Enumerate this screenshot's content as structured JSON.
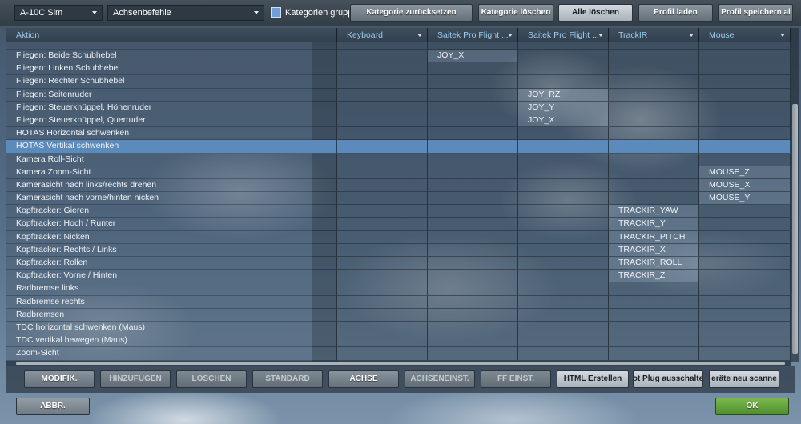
{
  "colors": {
    "header_text": "#9ccbee",
    "selection": "#5b8abb",
    "checkbox": "#6e9fd8",
    "ok_button": "#4f8f2c"
  },
  "icons": {
    "dropdown_arrow": "chevron-down-icon",
    "checkbox": "checkbox-checked-icon"
  },
  "toolbar": {
    "aircraft": "A-10C Sim",
    "category": "Achsenbefehle",
    "group_label": "Kategorien gruppi",
    "group_checked": true,
    "reset_category": "Kategorie zurücksetzen",
    "clear_category": "Kategorie löschen",
    "clear_all": "Alle löschen",
    "load_profile": "Profil laden",
    "save_profile_as": "Profil speichern al"
  },
  "table": {
    "headers": {
      "action": "Aktion",
      "keyboard": "Keyboard",
      "device1": "Saitek Pro Flight ...",
      "device2": "Saitek Pro Flight ...",
      "trackir": "TrackIR",
      "mouse": "Mouse"
    },
    "rows": [
      {
        "action": "Fliegen: Beide Schubhebel",
        "device1": "JOY_X"
      },
      {
        "action": "Fliegen: Linken Schubhebel"
      },
      {
        "action": "Fliegen: Rechter Schubhebel"
      },
      {
        "action": "Fliegen: Seitenruder",
        "device2": "JOY_RZ"
      },
      {
        "action": "Fliegen: Steuerknüppel, Höhenruder",
        "device2": "JOY_Y"
      },
      {
        "action": "Fliegen: Steuerknüppel, Querruder",
        "device2": "JOY_X"
      },
      {
        "action": "HOTAS Horizontal schwenken"
      },
      {
        "action": "HOTAS Vertikal schwenken",
        "selected": true
      },
      {
        "action": "Kamera Roll-Sicht"
      },
      {
        "action": "Kamera Zoom-Sicht",
        "mouse": "MOUSE_Z"
      },
      {
        "action": "Kamerasicht nach links/rechts drehen",
        "mouse": "MOUSE_X"
      },
      {
        "action": "Kamerasicht nach vorne/hinten nicken",
        "mouse": "MOUSE_Y"
      },
      {
        "action": "Kopftracker: Gieren",
        "trackir": "TRACKIR_YAW"
      },
      {
        "action": "Kopftracker: Hoch / Runter",
        "trackir": "TRACKIR_Y"
      },
      {
        "action": "Kopftracker: Nicken",
        "trackir": "TRACKIR_PITCH"
      },
      {
        "action": "Kopftracker: Rechts / Links",
        "trackir": "TRACKIR_X"
      },
      {
        "action": "Kopftracker: Rollen",
        "trackir": "TRACKIR_ROLL"
      },
      {
        "action": "Kopftracker: Vorne / Hinten",
        "trackir": "TRACKIR_Z"
      },
      {
        "action": "Radbremse links"
      },
      {
        "action": "Radbremse rechts"
      },
      {
        "action": "Radbremsen"
      },
      {
        "action": "TDC horizontal schwenken (Maus)"
      },
      {
        "action": "TDC vertikal bewegen (Maus)"
      },
      {
        "action": "Zoom-Sicht"
      }
    ]
  },
  "actions": {
    "modifiers": "MODIFIK.",
    "add": "HINZUFÜGEN",
    "delete": "LÖSCHEN",
    "default": "STANDARD",
    "axis": "ACHSE",
    "axis_tune": "ACHSENEINST.",
    "ff_tune": "FF EINST.",
    "make_html": "HTML Erstellen",
    "hot_plug": "ot Plug ausschalte",
    "rescan": "eräte neu scanne"
  },
  "footer": {
    "cancel": "ABBR.",
    "ok": "OK"
  }
}
